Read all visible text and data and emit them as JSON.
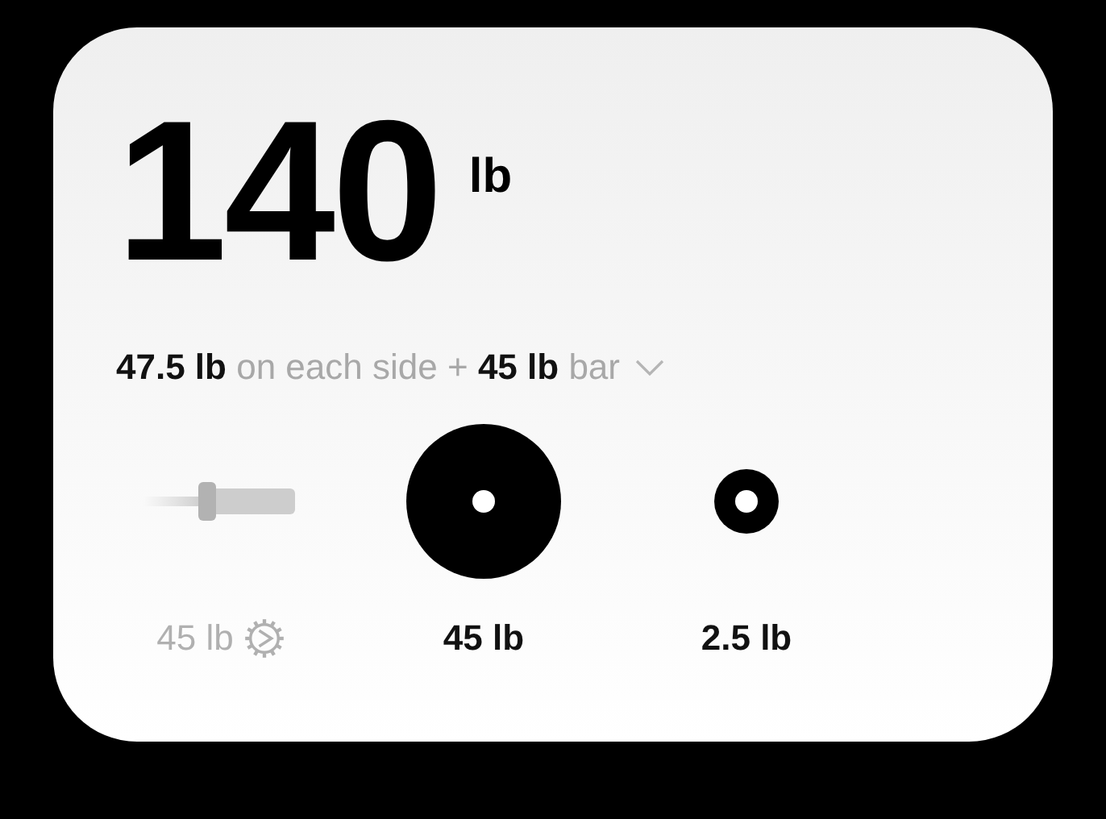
{
  "total": {
    "value": "140",
    "unit": "lb"
  },
  "summary": {
    "text": "**47.5 lb** on each side + **45 lb** bar",
    "expanded": false
  },
  "items": [
    {
      "kind": "bar",
      "label": "45 lb"
    },
    {
      "kind": "plate",
      "label": "45 lb"
    },
    {
      "kind": "fractional",
      "label": "2.5 lb"
    }
  ]
}
